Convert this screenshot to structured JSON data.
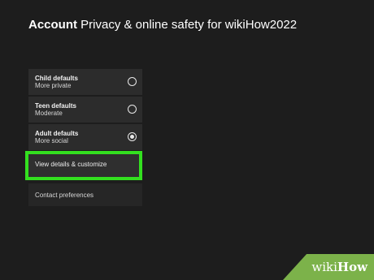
{
  "header": {
    "title_bold": "Account",
    "title_rest": "Privacy & online safety for wikiHow2022"
  },
  "options": [
    {
      "title": "Child defaults",
      "subtitle": "More private",
      "selected": false
    },
    {
      "title": "Teen defaults",
      "subtitle": "Moderate",
      "selected": false
    },
    {
      "title": "Adult defaults",
      "subtitle": "More social",
      "selected": true
    }
  ],
  "actions": {
    "view_details": "View details & customize",
    "contact_preferences": "Contact preferences"
  },
  "highlight_color": "#33e01f",
  "watermark": {
    "prefix": "wiki",
    "suffix": "How",
    "color": "#7cb24a"
  }
}
